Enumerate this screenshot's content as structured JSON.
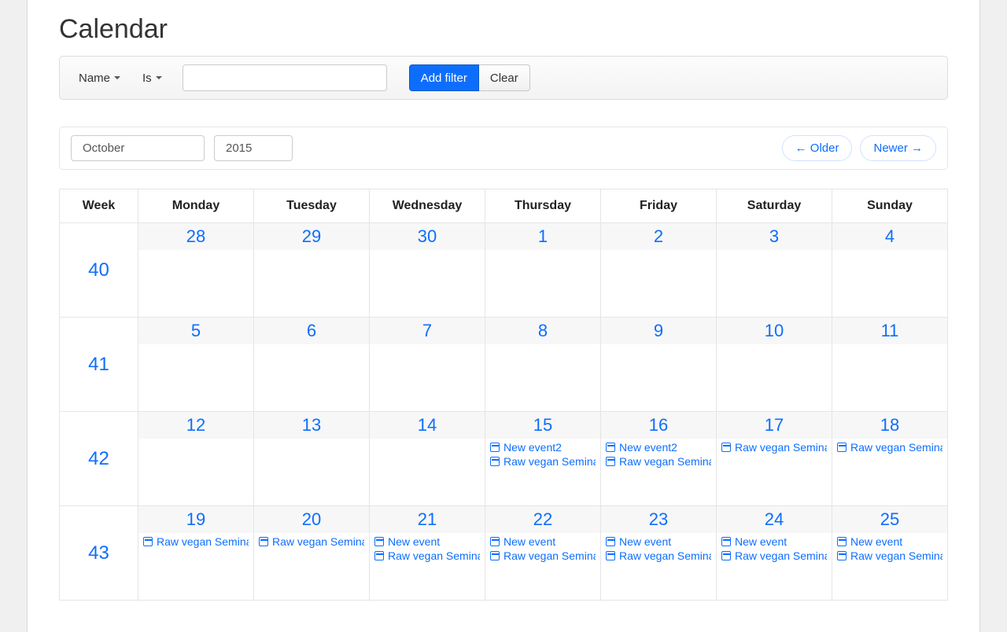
{
  "title": "Calendar",
  "filter": {
    "field_label": "Name",
    "op_label": "Is",
    "value": "",
    "add_label": "Add filter",
    "clear_label": "Clear"
  },
  "period": {
    "month": "October",
    "year": "2015",
    "older_label": "← Older",
    "newer_label": "Newer →"
  },
  "headers": [
    "Week",
    "Monday",
    "Tuesday",
    "Wednesday",
    "Thursday",
    "Friday",
    "Saturday",
    "Sunday"
  ],
  "weeks": [
    {
      "no": "40",
      "days": [
        {
          "d": "28",
          "events": []
        },
        {
          "d": "29",
          "events": []
        },
        {
          "d": "30",
          "events": []
        },
        {
          "d": "1",
          "events": []
        },
        {
          "d": "2",
          "events": []
        },
        {
          "d": "3",
          "events": []
        },
        {
          "d": "4",
          "events": []
        }
      ]
    },
    {
      "no": "41",
      "days": [
        {
          "d": "5",
          "events": []
        },
        {
          "d": "6",
          "events": []
        },
        {
          "d": "7",
          "events": []
        },
        {
          "d": "8",
          "events": []
        },
        {
          "d": "9",
          "events": []
        },
        {
          "d": "10",
          "events": []
        },
        {
          "d": "11",
          "events": []
        }
      ]
    },
    {
      "no": "42",
      "days": [
        {
          "d": "12",
          "events": []
        },
        {
          "d": "13",
          "events": []
        },
        {
          "d": "14",
          "events": []
        },
        {
          "d": "15",
          "events": [
            "New event2",
            "Raw vegan Seminar"
          ]
        },
        {
          "d": "16",
          "events": [
            "New event2",
            "Raw vegan Seminar"
          ]
        },
        {
          "d": "17",
          "events": [
            "Raw vegan Seminar"
          ]
        },
        {
          "d": "18",
          "events": [
            "Raw vegan Seminar"
          ]
        }
      ]
    },
    {
      "no": "43",
      "days": [
        {
          "d": "19",
          "events": [
            "Raw vegan Seminar"
          ]
        },
        {
          "d": "20",
          "events": [
            "Raw vegan Seminar"
          ]
        },
        {
          "d": "21",
          "events": [
            "New event",
            "Raw vegan Seminar"
          ]
        },
        {
          "d": "22",
          "events": [
            "New event",
            "Raw vegan Seminar"
          ]
        },
        {
          "d": "23",
          "events": [
            "New event",
            "Raw vegan Seminar"
          ]
        },
        {
          "d": "24",
          "events": [
            "New event",
            "Raw vegan Seminar"
          ]
        },
        {
          "d": "25",
          "events": [
            "New event",
            "Raw vegan Seminar"
          ]
        }
      ]
    }
  ]
}
